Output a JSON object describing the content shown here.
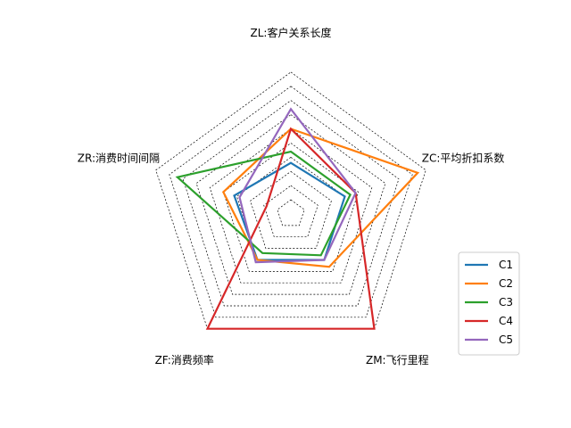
{
  "chart_data": {
    "type": "radar",
    "axes": [
      "ZL:客户关系长度",
      "ZC:平均折扣系数",
      "ZM:飞行里程",
      "ZF:消费频率",
      "ZR:消费时间间隔"
    ],
    "rlim": [
      -2.5,
      3.0
    ],
    "ring_values": [
      -2.0,
      -1.5,
      -1.0,
      -0.5,
      0.0,
      0.5,
      1.0,
      1.5,
      2.0,
      2.5
    ],
    "grid": true,
    "grid_style": "dashed",
    "legend_position": "right",
    "series": [
      {
        "name": "C1",
        "color": "#1f77b4",
        "values": [
          -0.7,
          -0.5,
          -0.5,
          -0.5,
          -0.4
        ]
      },
      {
        "name": "C2",
        "color": "#ff7f0e",
        "values": [
          0.5,
          2.2,
          -0.2,
          -0.5,
          0.0
        ]
      },
      {
        "name": "C3",
        "color": "#2ca02c",
        "values": [
          -0.3,
          -0.3,
          -0.7,
          -0.8,
          1.7
        ]
      },
      {
        "name": "C4",
        "color": "#d62728",
        "values": [
          0.5,
          -0.1,
          2.5,
          2.5,
          -1.6
        ]
      },
      {
        "name": "C5",
        "color": "#9467bd",
        "values": [
          1.2,
          -0.1,
          -0.5,
          -0.4,
          -0.6
        ]
      }
    ]
  }
}
